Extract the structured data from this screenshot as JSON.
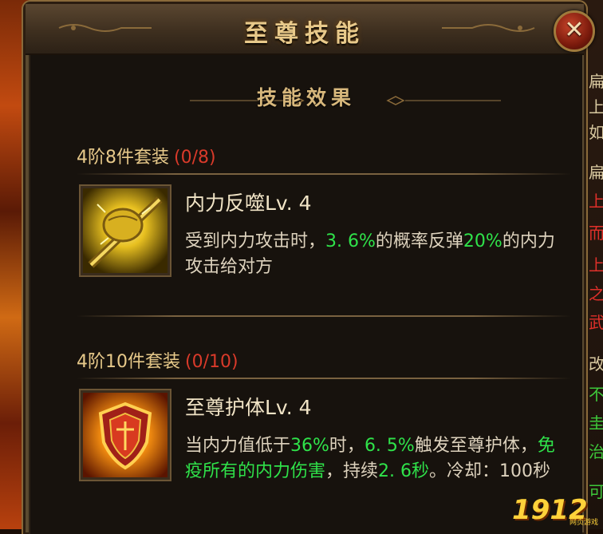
{
  "window": {
    "title": "至尊技能",
    "close_label": "✕"
  },
  "section": {
    "title": "技能效果"
  },
  "sets": [
    {
      "name": "4阶8件套装",
      "progress": "(0/8)",
      "skill_name": "内力反噬Lv. 4",
      "desc": [
        {
          "t": "受到内力攻击时，",
          "g": false
        },
        {
          "t": "3. 6%",
          "g": true
        },
        {
          "t": "的概率反弹",
          "g": false
        },
        {
          "t": "20%",
          "g": true
        },
        {
          "t": "的内力攻击给对方",
          "g": false
        }
      ],
      "icon": "golden-fist-icon"
    },
    {
      "name": "4阶10件套装",
      "progress": "(0/10)",
      "skill_name": "至尊护体Lv. 4",
      "desc": [
        {
          "t": "当内力值低于",
          "g": false
        },
        {
          "t": "36%",
          "g": true
        },
        {
          "t": "时，",
          "g": false
        },
        {
          "t": "6. 5%",
          "g": true
        },
        {
          "t": "触发至尊护体，",
          "g": false
        },
        {
          "t": "免疫所有的内力伤害",
          "g": true
        },
        {
          "t": "，持续",
          "g": false
        },
        {
          "t": "2. 6秒",
          "g": true
        },
        {
          "t": "。冷却：100秒",
          "g": false
        }
      ],
      "icon": "flame-shield-icon"
    }
  ],
  "side_glyphs": {
    "col": [
      "扁",
      "上",
      "如",
      "扁",
      "上",
      "而",
      "上",
      "之",
      "武",
      "改",
      "不",
      "圭",
      "治",
      "可"
    ]
  },
  "watermark": {
    "text": "1912",
    "sub": "网页游戏"
  },
  "colors": {
    "accent_gold": "#e7c98a",
    "count_red": "#d93a2a",
    "value_green": "#2fe24a"
  }
}
